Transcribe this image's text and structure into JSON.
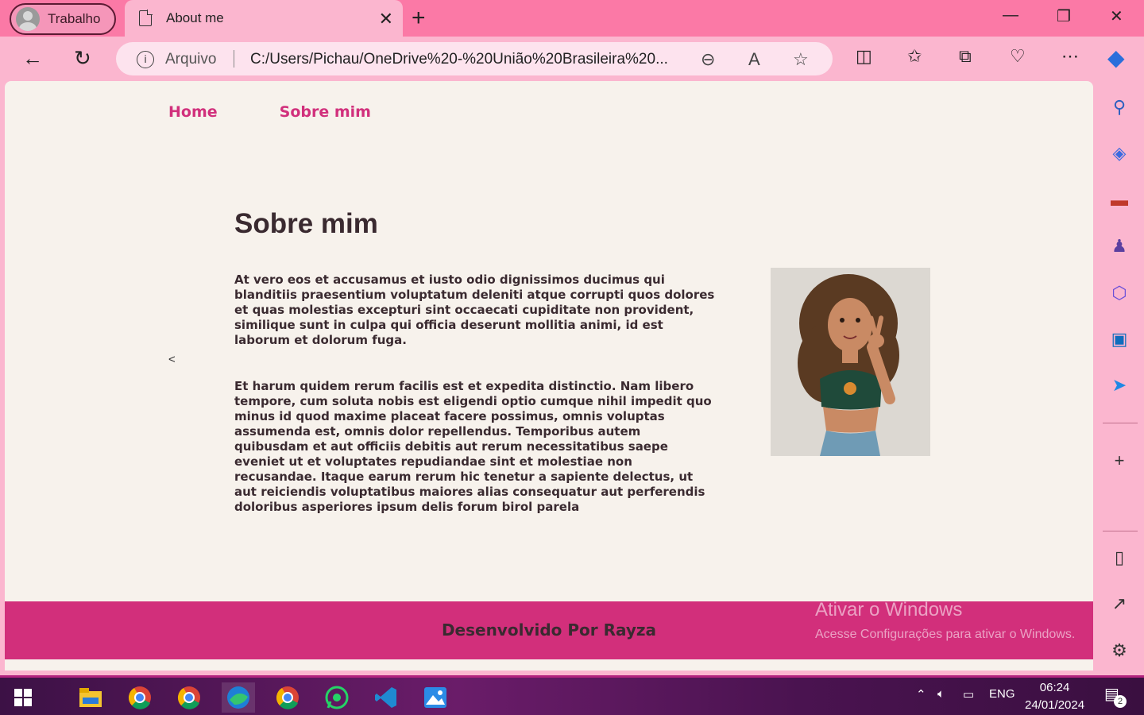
{
  "browser": {
    "profile_label": "Trabalho",
    "tab_title": "About me",
    "address_scheme": "Arquivo",
    "address_url": "C:/Users/Pichau/OneDrive%20-%20União%20Brasileira%20..."
  },
  "page": {
    "nav": [
      "Home",
      "Sobre mim"
    ],
    "heading": "Sobre mim",
    "paragraph1": "At vero eos et accusamus et iusto odio dignissimos ducimus qui blanditiis praesentium voluptatum deleniti atque corrupti quos dolores et quas molestias excepturi sint occaecati cupiditate non provident, similique sunt in culpa qui officia deserunt mollitia animi, id est laborum et dolorum fuga.",
    "paragraph2": "Et harum quidem rerum facilis est et expedita distinctio. Nam libero tempore, cum soluta nobis est eligendi optio cumque nihil impedit quo minus id quod maxime placeat facere possimus, omnis voluptas assumenda est, omnis dolor repellendus. Temporibus autem quibusdam et aut officiis debitis aut rerum necessitatibus saepe eveniet ut et voluptates repudiandae sint et molestiae non recusandae. Itaque earum rerum hic tenetur a sapiente delectus, ut aut reiciendis voluptatibus maiores alias consequatur aut perferendis doloribus asperiores ipsum delis forum birol parela",
    "stray_char": "<",
    "footer": "Desenvolvido Por Rayza"
  },
  "watermark": {
    "line1": "Ativar o Windows",
    "line2": "Acesse Configurações para ativar o Windows."
  },
  "taskbar": {
    "lang": "ENG",
    "time": "06:24",
    "date": "24/01/2024",
    "notifications": "2"
  },
  "colors": {
    "accent": "#d1307c",
    "footer_bg": "#d22f7b",
    "page_bg": "#f7f2ec",
    "chrome": "#fbb6cf"
  }
}
